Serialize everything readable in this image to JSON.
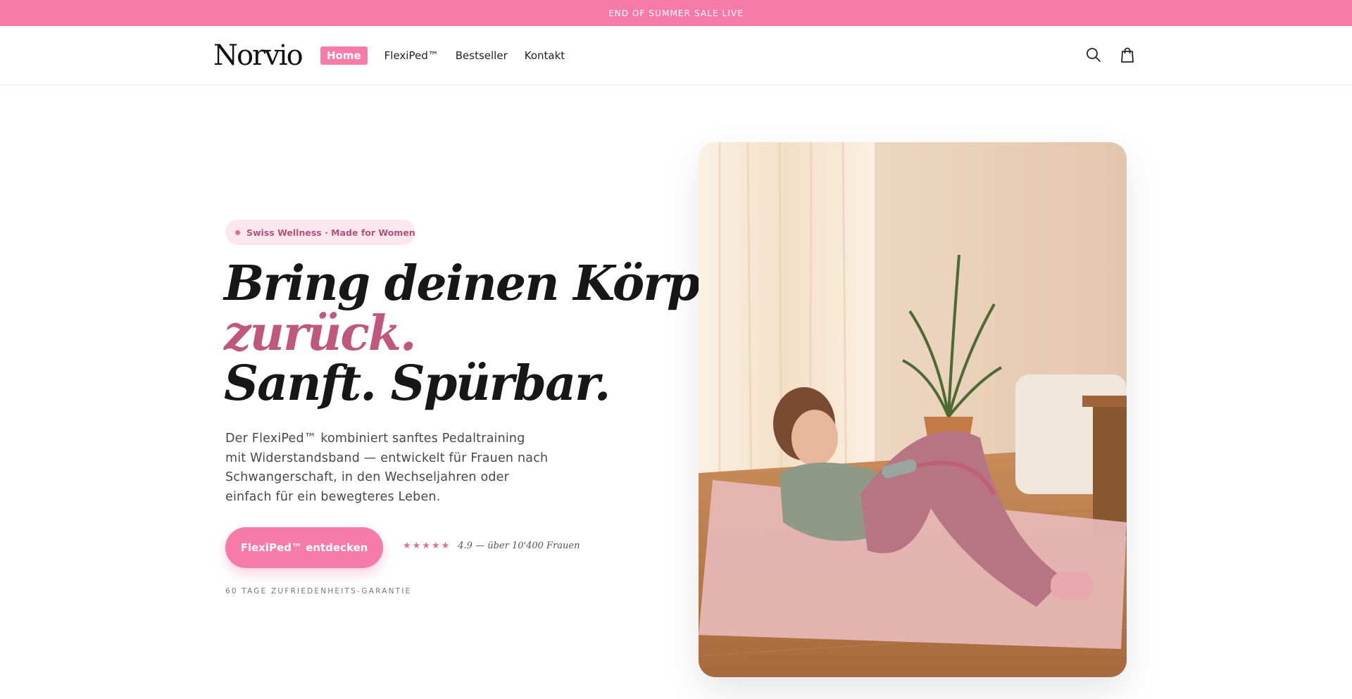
{
  "announcement": {
    "text": "END OF SUMMER SALE LIVE"
  },
  "header": {
    "logo": "Norvio",
    "nav": [
      {
        "label": "Home",
        "active": true
      },
      {
        "label": "FlexiPed™",
        "active": false
      },
      {
        "label": "Bestseller",
        "active": false
      },
      {
        "label": "Kontakt",
        "active": false
      }
    ],
    "icons": [
      "search-icon",
      "cart-icon"
    ]
  },
  "hero": {
    "badge": "Swiss Wellness · Made for Women",
    "headline": {
      "line1": "Bring deinen Körper",
      "line2": "zurück.",
      "line3": "Sanft. Spürbar."
    },
    "description": "Der FlexiPed™ kombiniert sanftes Pedaltraining mit Widerstandsband — entwickelt für Frauen nach Schwangerschaft, in den Wechseljahren oder einfach für ein bewegteres Leben.",
    "cta_label": "FlexiPed™ entdecken",
    "stars": "★★★★★",
    "rating_text": "4.9 — über 10'400 Frauen",
    "guarantee": "60 TAGE ZUFRIEDENHEITS-GARANTIE"
  },
  "colors": {
    "accent": "#f77ba8",
    "headline_pink": "#c0577f",
    "badge_bg": "#fde7ef"
  }
}
